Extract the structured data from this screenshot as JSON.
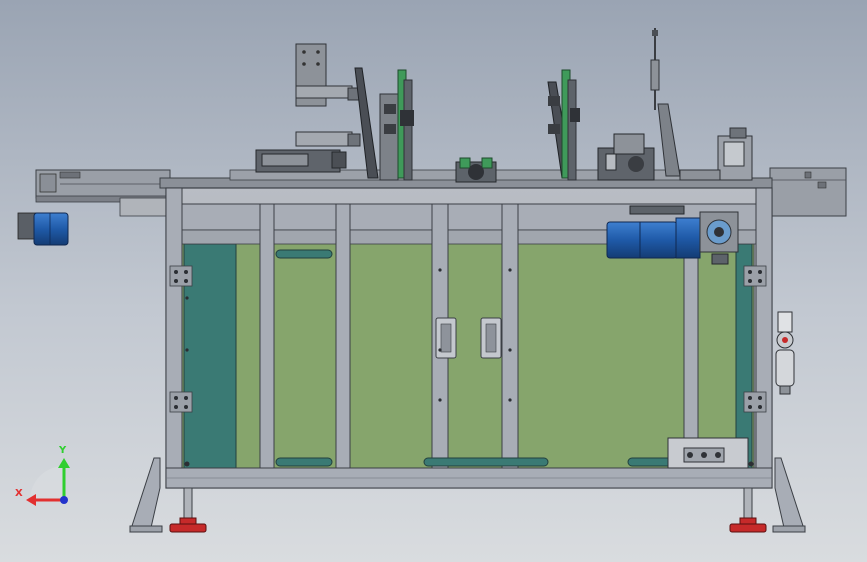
{
  "axes": {
    "y_label": "Y",
    "x_label": "X",
    "y_color": "#2fcf2f",
    "x_color": "#e23030",
    "z_color": "#2233cc"
  },
  "colors": {
    "background_top": "#9aa4b3",
    "frame": "#a8adb6",
    "panel_green": "#86a56c",
    "panel_teal": "#3a7a74",
    "motor_blue": "#1f5aa8",
    "foot_red": "#c62a2a",
    "rail_green": "#3c9a5c"
  }
}
